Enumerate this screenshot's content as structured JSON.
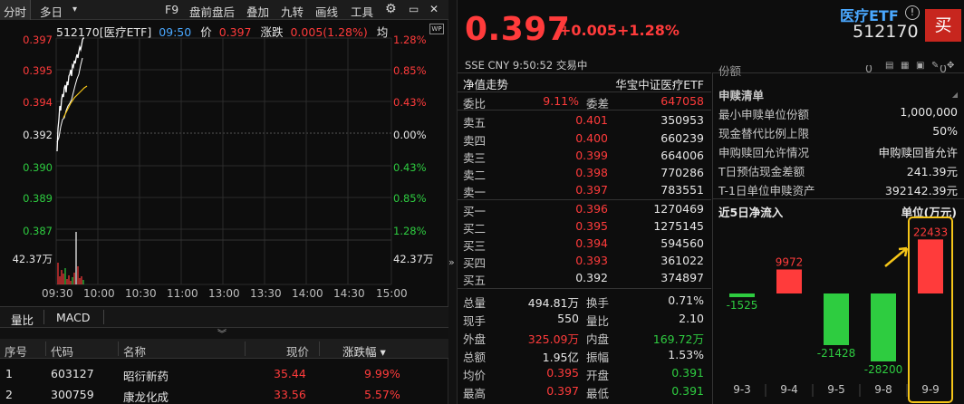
{
  "toolbar": {
    "tabs": [
      "分时",
      "多日",
      "▾",
      "F9",
      "盘前盘后",
      "叠加",
      "九转",
      "画线",
      "工具"
    ],
    "active": "分时"
  },
  "chart": {
    "code_name": "512170[医疗ETF]",
    "time": "09:50",
    "price_label": "价",
    "price": "0.397",
    "change_label": "涨跌",
    "change": "0.005(1.28%)",
    "avg_label": "均",
    "y_left": [
      "0.397",
      "0.395",
      "0.394",
      "0.392",
      "0.390",
      "0.389",
      "0.387"
    ],
    "y_right": [
      "1.28%",
      "0.85%",
      "0.43%",
      "0.00%",
      "0.43%",
      "0.85%",
      "1.28%"
    ],
    "vol_label_left": "42.37万",
    "vol_label_right": "42.37万",
    "x_ticks": [
      "09:30",
      "10:00",
      "10:30",
      "11:00",
      "13:00",
      "13:30",
      "14:00",
      "14:30",
      "15:00"
    ]
  },
  "indicator_tabs": [
    "量比",
    "MACD"
  ],
  "stock_table": {
    "headers": [
      "序号",
      "代码",
      "名称",
      "现价",
      "涨跌幅 ▾"
    ],
    "rows": [
      [
        "1",
        "603127",
        "昭衍新药",
        "35.44",
        "9.99%"
      ],
      [
        "2",
        "300759",
        "康龙化成",
        "33.56",
        "5.57%"
      ]
    ]
  },
  "quote": {
    "price": "0.397",
    "change": "+0.005",
    "pct": "+1.28%",
    "meta": "SSE   CNY   9:50:52   交易中",
    "etf_name": "医疗ETF",
    "etf_code": "512170",
    "buy": "买",
    "info": "!"
  },
  "book": {
    "title": "净值走势",
    "fund_name": "华宝中证医疗ETF",
    "weibi_label": "委比",
    "weibi": "9.11%",
    "weicha_label": "委差",
    "weicha": "647058",
    "asks": [
      [
        "卖五",
        "0.401",
        "350953"
      ],
      [
        "卖四",
        "0.400",
        "660239"
      ],
      [
        "卖三",
        "0.399",
        "664006"
      ],
      [
        "卖二",
        "0.398",
        "770286"
      ],
      [
        "卖一",
        "0.397",
        "783551"
      ]
    ],
    "bids": [
      [
        "买一",
        "0.396",
        "1270469"
      ],
      [
        "买二",
        "0.395",
        "1275145"
      ],
      [
        "买三",
        "0.394",
        "594560"
      ],
      [
        "买四",
        "0.393",
        "361022"
      ],
      [
        "买五",
        "0.392",
        "374897"
      ]
    ],
    "stats": [
      [
        "总量",
        "494.81万",
        "换手",
        "0.71%"
      ],
      [
        "现手",
        "550",
        "量比",
        "2.10"
      ],
      [
        "外盘",
        "325.09万",
        "内盘",
        "169.72万"
      ],
      [
        "总额",
        "1.95亿",
        "振幅",
        "1.53%"
      ],
      [
        "均价",
        "0.395",
        "开盘",
        "0.391"
      ],
      [
        "最高",
        "0.397",
        "最低",
        "0.391"
      ]
    ]
  },
  "sub_panel": {
    "top_cut": "份额",
    "top_zero_a": "0",
    "top_zero_b": "0",
    "title": "申赎清单",
    "rows": [
      [
        "最小申赎单位份额",
        "1,000,000"
      ],
      [
        "现金替代比例上限",
        "50%"
      ],
      [
        "申购赎回允许情况",
        "申购赎回皆允许"
      ],
      [
        "T日预估现金差额",
        "241.39元"
      ],
      [
        "T-1日单位申赎资产",
        "392142.39元"
      ]
    ],
    "flow_title": "近5日净流入",
    "flow_unit": "单位(万元)"
  },
  "chart_data": {
    "type": "bar",
    "title": "近5日净流入",
    "ylabel": "单位(万元)",
    "categories": [
      "9-3",
      "9-4",
      "9-5",
      "9-8",
      "9-9"
    ],
    "values": [
      -1525,
      9972,
      -21428,
      -28200,
      22433
    ],
    "value_labels": [
      "-1525",
      "9972",
      "-21428",
      "-28200",
      "22433"
    ],
    "colors": {
      "positive": "#ff3b3b",
      "negative": "#2ecc40",
      "highlight": "#f5c518"
    }
  }
}
